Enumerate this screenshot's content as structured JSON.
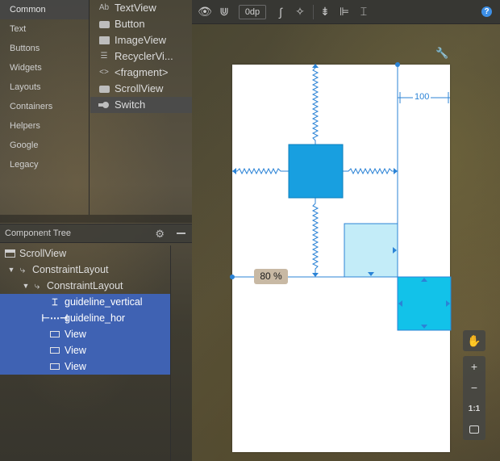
{
  "palette": {
    "categories": [
      "Common",
      "Text",
      "Buttons",
      "Widgets",
      "Layouts",
      "Containers",
      "Helpers",
      "Google",
      "Legacy"
    ],
    "selected_category": "Common",
    "items": [
      {
        "label": "TextView",
        "icon": "textview-icon"
      },
      {
        "label": "Button",
        "icon": "button-icon"
      },
      {
        "label": "ImageView",
        "icon": "imageview-icon"
      },
      {
        "label": "RecyclerVi...",
        "icon": "list-icon"
      },
      {
        "label": "<fragment>",
        "icon": "code-icon"
      },
      {
        "label": "ScrollView",
        "icon": "scrollview-icon"
      },
      {
        "label": "Switch",
        "icon": "switch-icon"
      }
    ],
    "selected_item": "Switch"
  },
  "component_tree": {
    "title": "Component Tree",
    "rows": [
      {
        "label": "ScrollView",
        "icon": "scrollview-icon",
        "depth": 0,
        "arrow": "",
        "selected": false
      },
      {
        "label": "ConstraintLayout",
        "icon": "constraint-layout-icon",
        "depth": 1,
        "arrow": "▼",
        "selected": false
      },
      {
        "label": "ConstraintLayout",
        "icon": "constraint-layout-icon",
        "depth": 2,
        "arrow": "▼",
        "selected": false
      },
      {
        "label": "guideline_vertical",
        "icon": "guideline-vertical-icon",
        "depth": 3,
        "arrow": "",
        "selected": true
      },
      {
        "label": "guideline_hor",
        "icon": "guideline-horizontal-icon",
        "depth": 3,
        "arrow": "",
        "selected": true
      },
      {
        "label": "View",
        "icon": "view-icon",
        "depth": 3,
        "arrow": "",
        "selected": true
      },
      {
        "label": "View",
        "icon": "view-icon",
        "depth": 3,
        "arrow": "",
        "selected": true
      },
      {
        "label": "View",
        "icon": "view-icon",
        "depth": 3,
        "arrow": "",
        "selected": true
      }
    ]
  },
  "toolbar": {
    "default_margin": "0dp",
    "icons": [
      "eye-icon",
      "magnet-icon",
      "clear-constraints-icon",
      "infer-constraints-icon",
      "pack-icon",
      "align-icon",
      "guidelines-icon",
      "help-icon"
    ]
  },
  "canvas": {
    "guideline_percent_label": "80 %",
    "distance_label": "100",
    "colors": {
      "view_blue": "#189fe0",
      "view_light": "#c3ecf8",
      "view_cyan": "#12c2e9",
      "constraint": "#2b83d6",
      "selection_bg": "#3f62b3"
    }
  },
  "zoom_controls": {
    "one_to_one_label": "1:1"
  }
}
